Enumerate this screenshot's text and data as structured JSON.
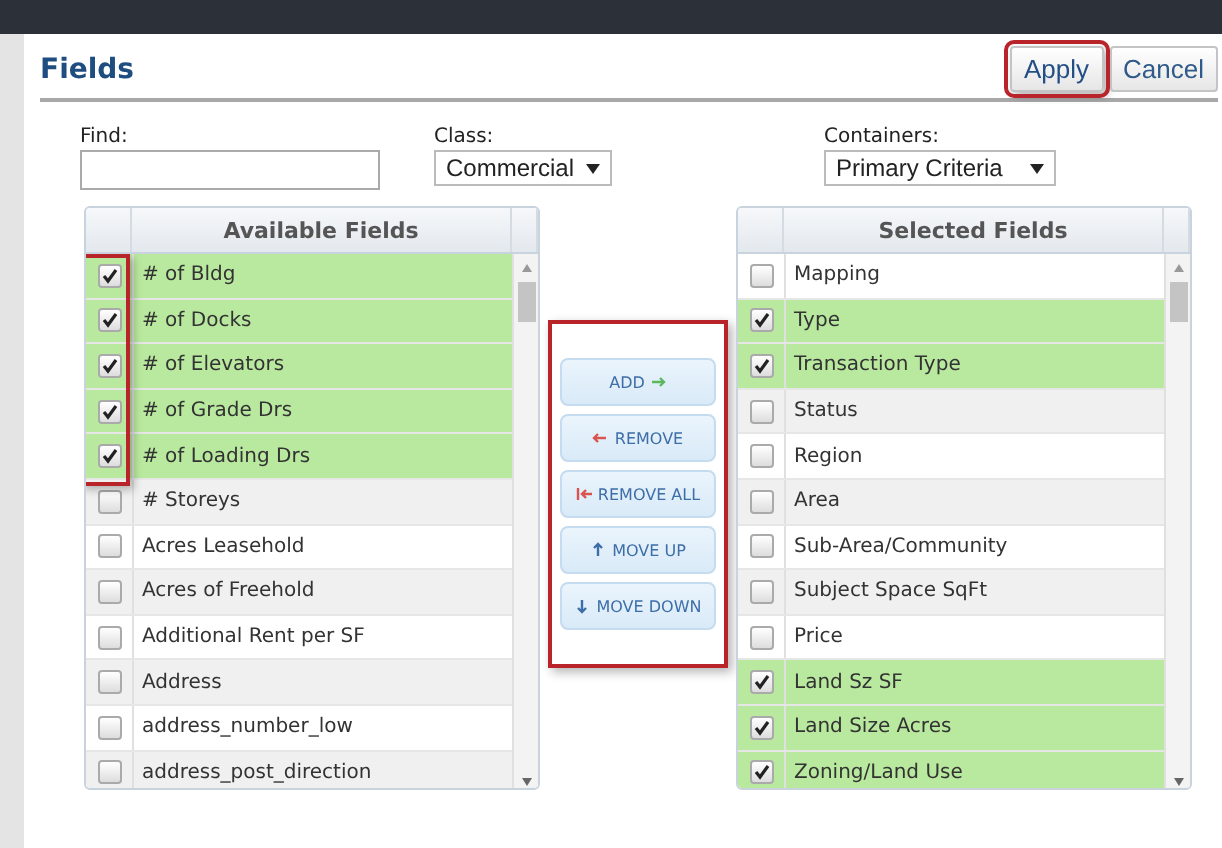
{
  "dialog": {
    "title": "Fields",
    "buttons": [
      {
        "label": "Apply",
        "kind": "primary",
        "highlighted": true
      },
      {
        "label": "Cancel",
        "kind": "secondary",
        "highlighted": false
      }
    ]
  },
  "filters": {
    "find": {
      "label": "Find:"
    },
    "class": {
      "label": "Class:",
      "value": "Commercial"
    },
    "containers": {
      "label": "Containers:",
      "value": "Primary Criteria"
    }
  },
  "available_fields": {
    "title": "Available Fields",
    "checks_highlighted": true,
    "rows": [
      {
        "label": "# of Bldg",
        "checked": true
      },
      {
        "label": "# of Docks",
        "checked": true
      },
      {
        "label": "# of Elevators",
        "checked": true
      },
      {
        "label": "# of Grade Drs",
        "checked": true
      },
      {
        "label": "# of Loading Drs",
        "checked": true
      },
      {
        "label": "# Storeys",
        "checked": false
      },
      {
        "label": "Acres Leasehold",
        "checked": false
      },
      {
        "label": "Acres of Freehold",
        "checked": false
      },
      {
        "label": "Additional Rent per SF",
        "checked": false
      },
      {
        "label": "Address",
        "checked": false
      },
      {
        "label": "address_number_low",
        "checked": false
      },
      {
        "label": "address_post_direction",
        "checked": false
      }
    ]
  },
  "actions": {
    "highlighted": true,
    "buttons": [
      {
        "label": "ADD",
        "kind": "add"
      },
      {
        "label": "REMOVE",
        "kind": "remove"
      },
      {
        "label": "REMOVE ALL",
        "kind": "remove_all"
      },
      {
        "label": "MOVE UP",
        "kind": "up"
      },
      {
        "label": "MOVE DOWN",
        "kind": "down"
      }
    ]
  },
  "selected_fields": {
    "title": "Selected Fields",
    "rows": [
      {
        "label": "Mapping",
        "checked": false
      },
      {
        "label": "Type",
        "checked": true
      },
      {
        "label": "Transaction Type",
        "checked": true
      },
      {
        "label": "Status",
        "checked": false
      },
      {
        "label": "Region",
        "checked": false
      },
      {
        "label": "Area",
        "checked": false
      },
      {
        "label": "Sub-Area/Community",
        "checked": false
      },
      {
        "label": "Subject Space SqFt",
        "checked": false
      },
      {
        "label": "Price",
        "checked": false
      },
      {
        "label": "Land Sz SF",
        "checked": true
      },
      {
        "label": "Land Size Acres",
        "checked": true
      },
      {
        "label": "Zoning/Land Use",
        "checked": true
      }
    ]
  }
}
